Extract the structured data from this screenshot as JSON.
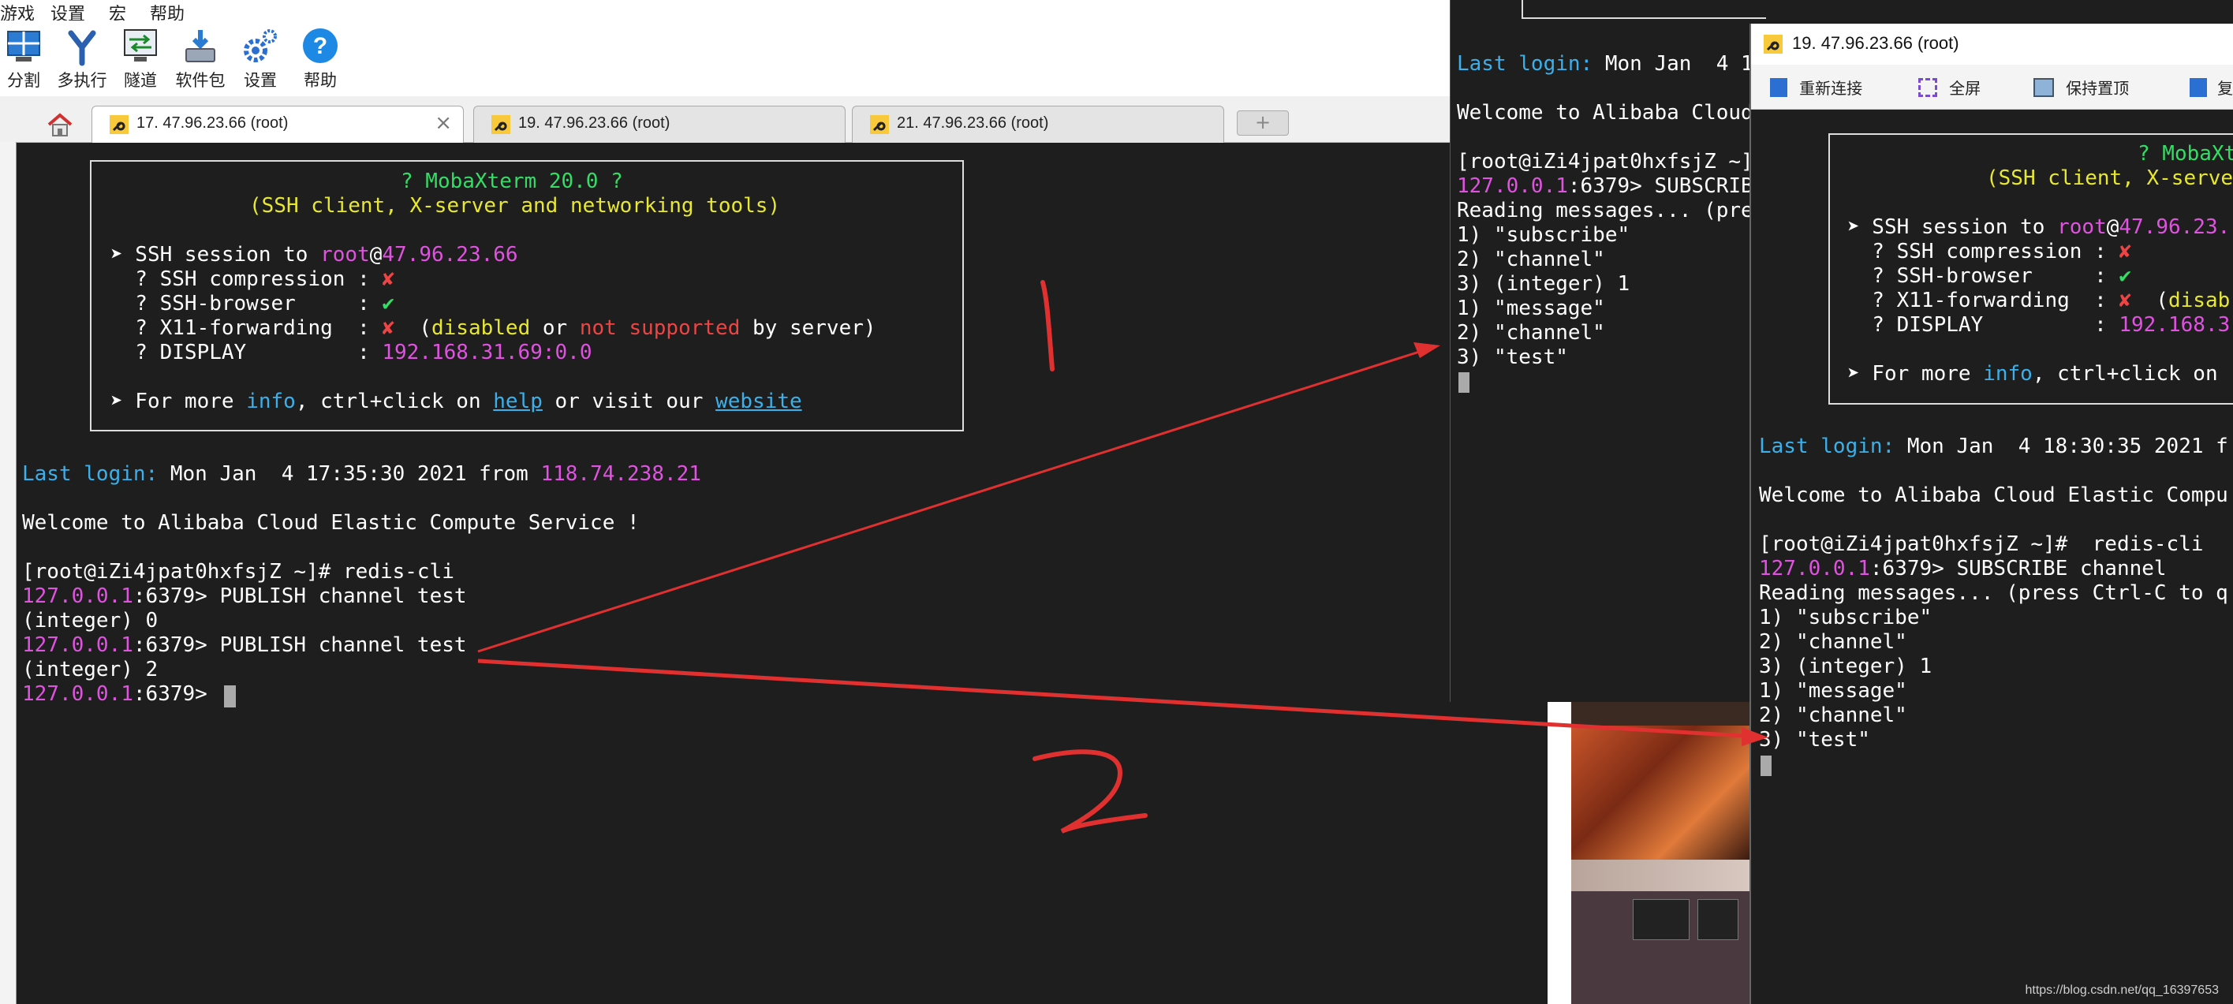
{
  "menu": [
    "游戏",
    "设置",
    "宏",
    "帮助"
  ],
  "toolbar": [
    {
      "label": "分割",
      "icon": "split-screen-icon"
    },
    {
      "label": "多执行",
      "icon": "multi-exec-icon"
    },
    {
      "label": "隧道",
      "icon": "tunnel-icon"
    },
    {
      "label": "软件包",
      "icon": "packages-icon"
    },
    {
      "label": "设置",
      "icon": "gear-icon"
    },
    {
      "label": "帮助",
      "icon": "help-icon"
    }
  ],
  "tabs": [
    {
      "label": "17. 47.96.23.66 (root)",
      "active": true
    },
    {
      "label": "19. 47.96.23.66 (root)",
      "active": false
    },
    {
      "label": "21. 47.96.23.66 (root)",
      "active": false
    }
  ],
  "term1": {
    "banner": {
      "title": "? MobaXterm 20.0 ?",
      "subtitle": "(SSH client, X-server and networking tools)",
      "ssh_prefix": "➤ SSH session to ",
      "user": "root",
      "at": "@",
      "host": "47.96.23.66",
      "compression_label": "  ? SSH compression : ",
      "cross": "✘",
      "browser_label": "  ? SSH-browser     : ",
      "check": "✔",
      "x11_label": "  ? X11-forwarding  : ",
      "x11_open": "  (",
      "disabled": "disabled",
      "or": " or ",
      "not_supported": "not supported",
      "by_server": " by server)",
      "display_label": "  ? DISPLAY         : ",
      "display_value": "192.168.31.69:0.0",
      "more_prefix": "➤ For more ",
      "info": "info",
      "more_mid": ", ctrl+click on ",
      "help": "help",
      "more_mid2": " or visit our ",
      "website": "website"
    },
    "last_login_label": "Last login:",
    "last_login_value": " Mon Jan  4 17:35:30 2021 from ",
    "last_login_ip": "118.74.238.21",
    "welcome": "Welcome to Alibaba Cloud Elastic Compute Service !",
    "prompt_cmd": "[root@iZi4jpat0hxfsjZ ~]# redis-cli",
    "redis_host": "127.0.0.1",
    "redis_port": ":6379> ",
    "cmd1": "PUBLISH channel test",
    "result1": "(integer) 0",
    "cmd2": "PUBLISH channel test",
    "result2": "(integer) 2"
  },
  "term2": {
    "last_login_label": "Last login:",
    "last_login_value": " Mon Jan  4 1",
    "welcome": "Welcome to Alibaba Cloud",
    "prompt_cmd": "[root@iZi4jpat0hxfsjZ ~]",
    "redis_host": "127.0.0.1",
    "redis_port": ":6379> ",
    "cmd": "SUBSCRIBE",
    "reading": "Reading messages... (pre",
    "lines": [
      "1) \"subscribe\"",
      "2) \"channel\"",
      "3) (integer) 1",
      "1) \"message\"",
      "2) \"channel\"",
      "3) \"test\""
    ]
  },
  "win3": {
    "title": "19. 47.96.23.66 (root)",
    "toolbar": [
      "重新连接",
      "全屏",
      "保持置顶",
      "复"
    ],
    "banner_title": "? MobaXt",
    "banner_subtitle": "(SSH client, X-serve",
    "ssh_prefix": "➤ SSH session to ",
    "user": "root",
    "at": "@",
    "host": "47.96.23.",
    "compression_label": "  ? SSH compression : ",
    "cross": "✘",
    "browser_label": "  ? SSH-browser     : ",
    "check": "✔",
    "x11_label": "  ? X11-forwarding  : ",
    "x11_open": "  (",
    "x11_tail": "disab",
    "display_label": "  ? DISPLAY         : ",
    "display_value": "192.168.3",
    "more_prefix": "➤ For more ",
    "info": "info",
    "more_mid": ", ctrl+click on",
    "last_login_label": "Last login:",
    "last_login_value": " Mon Jan  4 18:30:35 2021 f",
    "welcome": "Welcome to Alibaba Cloud Elastic Compu",
    "prompt_cmd": "[root@iZi4jpat0hxfsjZ ~]#  redis-cli",
    "redis_host": "127.0.0.1",
    "redis_port": ":6379> ",
    "cmd": "SUBSCRIBE channel",
    "reading": "Reading messages... (press Ctrl-C to q",
    "lines": [
      "1) \"subscribe\"",
      "2) \"channel\"",
      "3) (integer) 1",
      "1) \"message\"",
      "2) \"channel\"",
      "3) \"test\""
    ]
  },
  "annotations": {
    "one": "1",
    "two": "2",
    "arrow_color": "#e03030"
  },
  "watermark": "https://blog.csdn.net/qq_16397653"
}
